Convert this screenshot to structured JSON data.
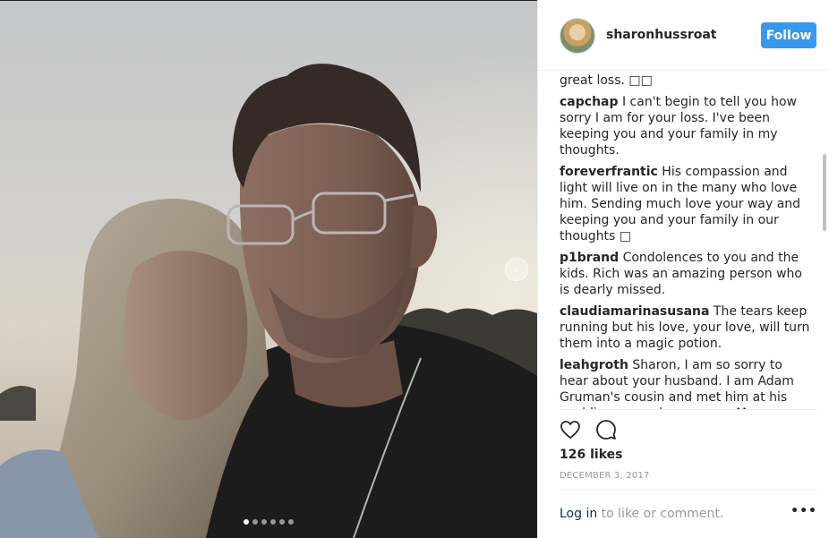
{
  "post": {
    "username": "sharonhussroat",
    "follow_label": "Follow",
    "partial_comment": "great loss. □□",
    "comments": [
      {
        "author": "capchap",
        "text": "I can't begin to tell you how sorry I am for your loss. I've been keeping you and your family in my thoughts."
      },
      {
        "author": "foreverfrantic",
        "text": "His compassion and light will live on in the many who love him. Sending much love your way and keeping you and your family in our thoughts □"
      },
      {
        "author": "p1brand",
        "text": "Condolences to you and the kids. Rich was an amazing person who is dearly missed."
      },
      {
        "author": "claudiamarinasusana",
        "text": "The tears keep running but his love, your love, will turn them into a magic potion."
      },
      {
        "author": "leahgroth",
        "text": "Sharon, I am so sorry to hear about your husband. I am Adam Gruman's cousin and met him at his wedding several years ago. My"
      }
    ],
    "likes": "126 likes",
    "date": "DECEMBER 3, 2017",
    "login_link": "Log in",
    "login_rest": " to like or comment.",
    "more_icon": "•••"
  },
  "carousel": {
    "slide_count": 6,
    "active_index": 0,
    "next_arrow": "›"
  },
  "icons": {
    "like": "heart-icon",
    "comment": "comment-icon",
    "next": "chevron-right-icon",
    "more": "more-options-icon"
  },
  "colors": {
    "follow_bg": "#3897f0",
    "link": "#003569",
    "muted": "#999999",
    "text": "#262626"
  }
}
